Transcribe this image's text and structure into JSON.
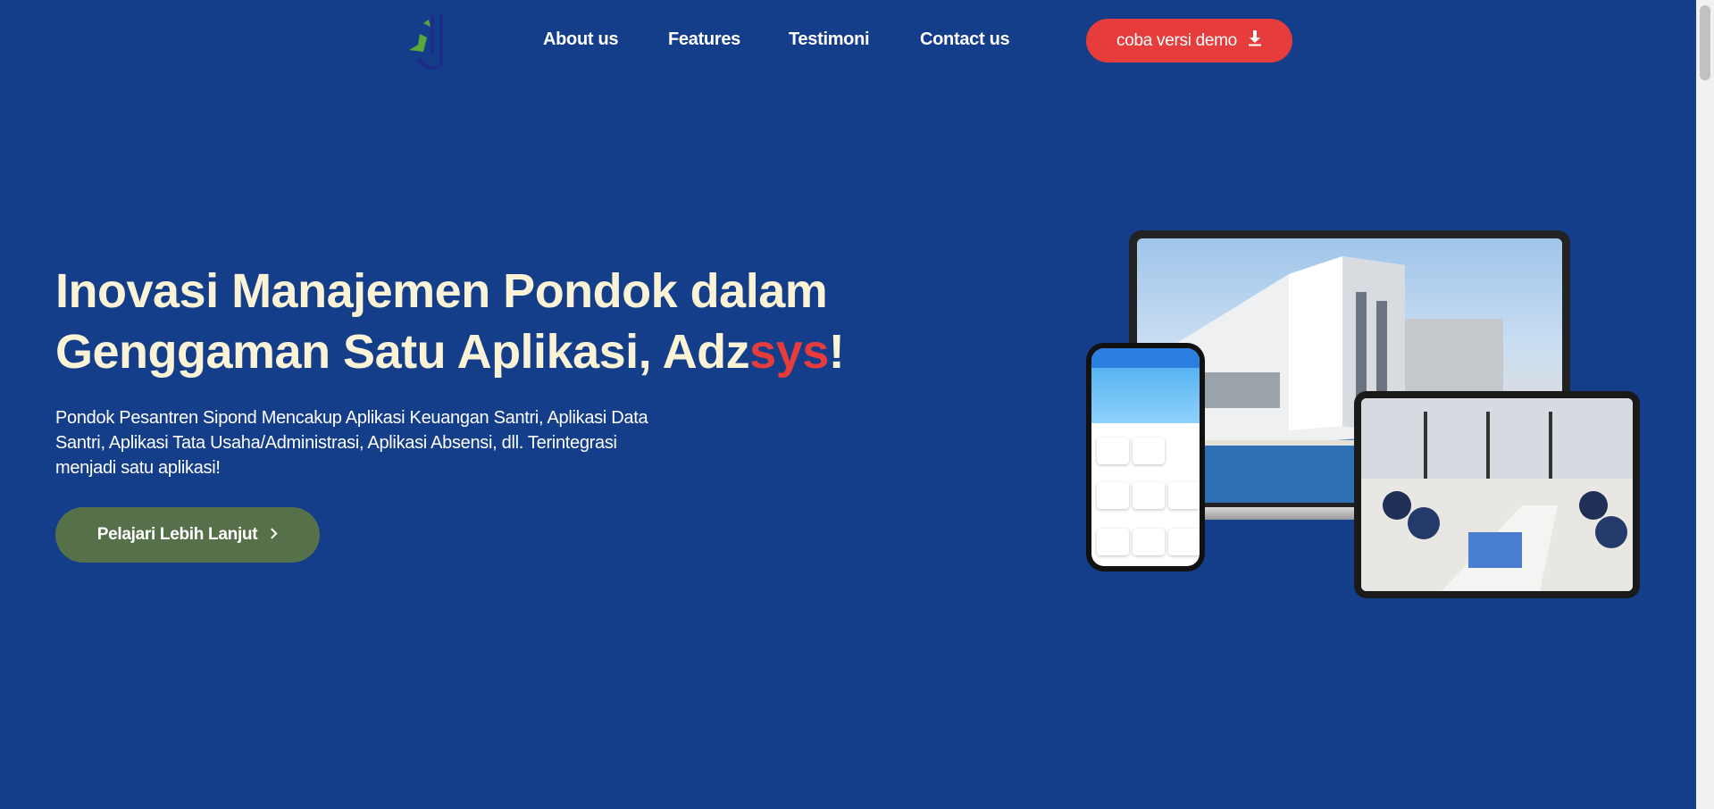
{
  "nav": {
    "links": [
      "About us",
      "Features",
      "Testimoni",
      "Contact us"
    ],
    "demo_button": "coba versi demo"
  },
  "hero": {
    "title_line1": "Inovasi Manajemen Pondok dalam",
    "title_line2_prefix": "Genggaman Satu Aplikasi, Adz",
    "title_line2_accent": "sys",
    "title_line2_suffix": "!",
    "description": "Pondok Pesantren Sipond Mencakup Aplikasi Keuangan Santri, Aplikasi Data Santri, Aplikasi Tata Usaha/Administrasi, Aplikasi Absensi, dll. Terintegrasi menjadi satu aplikasi!",
    "cta_button": "Pelajari Lebih Lanjut"
  },
  "colors": {
    "background": "#143d8a",
    "accent": "#e63c3c",
    "cta": "#56704a",
    "title": "#fbf3d6"
  }
}
